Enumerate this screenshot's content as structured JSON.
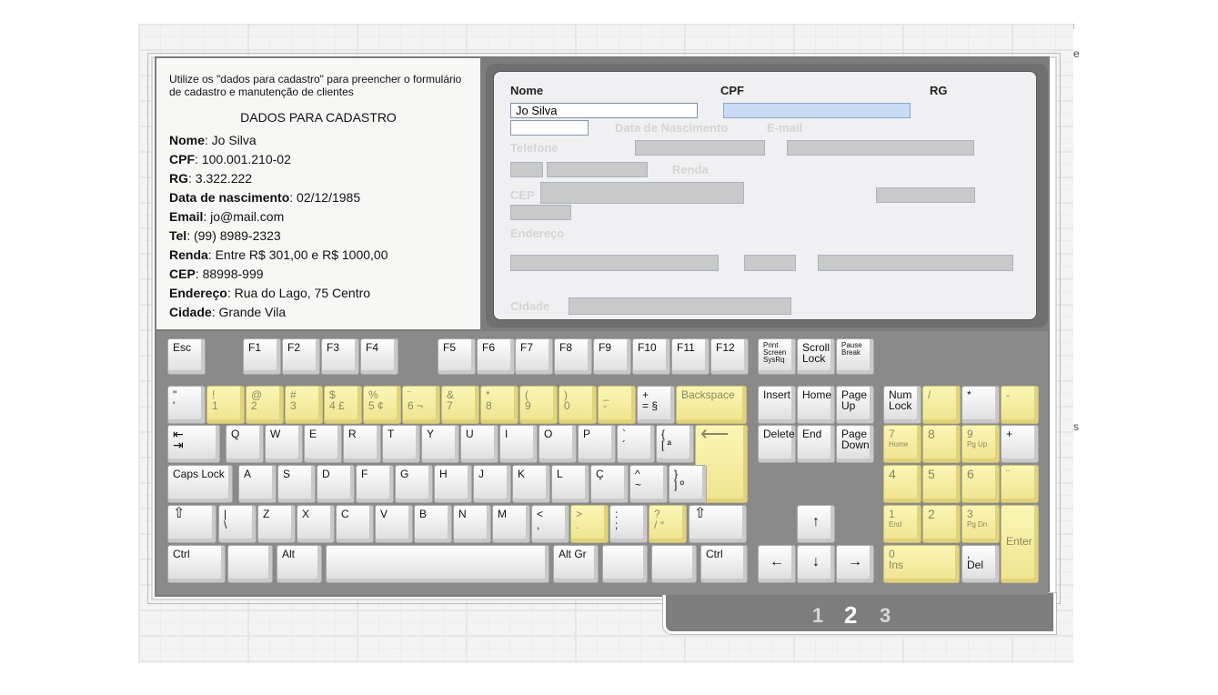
{
  "info": {
    "intro": "Utilize os \"dados para cadastro\" para preencher o formulário de cadastro e manutenção de clientes",
    "heading": "DADOS PARA CADASTRO",
    "rows": [
      {
        "label": "Nome",
        "value": ": Jo Silva"
      },
      {
        "label": "CPF",
        "value": ": 100.001.210-02"
      },
      {
        "label": "RG",
        "value": ": 3.322.222"
      },
      {
        "label": "Data de nascimento",
        "value": ": 02/12/1985"
      },
      {
        "label": "Email",
        "value": ": jo@mail.com"
      },
      {
        "label": "Tel",
        "value": ": (99) 8989-2323"
      },
      {
        "label": "Renda",
        "value": ": Entre R$ 301,00 e R$ 1000,00"
      },
      {
        "label": "CEP",
        "value": ": 88998-999"
      },
      {
        "label": "Endereço",
        "value": ": Rua do Lago, 75 Centro"
      },
      {
        "label": "Cidade",
        "value": ": Grande Vila"
      }
    ]
  },
  "form": {
    "labels": {
      "nome": "Nome",
      "cpf": "CPF",
      "rg": "RG",
      "nascimento": "Data de Nascimento",
      "email": "E-mail",
      "telefone": "Telefone",
      "renda": "Renda",
      "cep": "CEP",
      "endereco": "Endereço",
      "cidade": "Cidade"
    },
    "nome_value": "Jo Silva"
  },
  "keyboard": {
    "fn_row": [
      "Esc",
      "F1",
      "F2",
      "F3",
      "F4",
      "F5",
      "F6",
      "F7",
      "F8",
      "F9",
      "F10",
      "F11",
      "F12"
    ],
    "print": [
      "Print",
      "Screen",
      "SysRq"
    ],
    "scroll": [
      "Scroll",
      "Lock"
    ],
    "pause": [
      "Pause",
      "Break"
    ],
    "num_row": [
      {
        "t": "\"",
        "b": "'"
      },
      {
        "t": "!",
        "b": "1"
      },
      {
        "t": "@",
        "b": "2"
      },
      {
        "t": "#",
        "b": "3"
      },
      {
        "t": "$",
        "b": "4 £"
      },
      {
        "t": "%",
        "b": "5 ¢"
      },
      {
        "t": "¨",
        "b": "6 ¬"
      },
      {
        "t": "&",
        "b": "7"
      },
      {
        "t": "*",
        "b": "8"
      },
      {
        "t": "(",
        "b": "9"
      },
      {
        "t": ")",
        "b": "0"
      },
      {
        "t": "_",
        "b": "-"
      },
      {
        "t": "+",
        "b": "= §"
      }
    ],
    "backspace": "Backspace",
    "tab_glyph": "⇤\n⇥",
    "q_row": [
      "Q",
      "W",
      "E",
      "R",
      "T",
      "Y",
      "U",
      "I",
      "O",
      "P"
    ],
    "q_extra": [
      {
        "t": "`",
        "b": "´"
      },
      {
        "t": "{",
        "b": "[ ª"
      }
    ],
    "enter_glyph": "⟵",
    "caps": "Caps Lock",
    "a_row": [
      "A",
      "S",
      "D",
      "F",
      "G",
      "H",
      "J",
      "K",
      "L",
      "Ç"
    ],
    "a_extra": [
      {
        "t": "^",
        "b": "~"
      },
      {
        "t": "}",
        "b": "] º"
      }
    ],
    "shift_glyph": "⇧",
    "z_row": [
      {
        "t": "|",
        "b": "\\"
      },
      {
        "t": "Z",
        "b": ""
      },
      {
        "t": "X",
        "b": ""
      },
      {
        "t": "C",
        "b": ""
      },
      {
        "t": "V",
        "b": ""
      },
      {
        "t": "B",
        "b": ""
      },
      {
        "t": "N",
        "b": ""
      },
      {
        "t": "M",
        "b": ""
      },
      {
        "t": "<",
        "b": ","
      },
      {
        "t": ">",
        "b": "."
      },
      {
        "t": ":",
        "b": ";"
      },
      {
        "t": "?",
        "b": "/ °"
      }
    ],
    "ctrl": "Ctrl",
    "alt": "Alt",
    "altgr": "Alt Gr",
    "nav": {
      "insert": "Insert",
      "home": "Home",
      "pageup": [
        "Page",
        "Up"
      ],
      "delete": "Delete",
      "end": "End",
      "pagedown": [
        "Page",
        "Down"
      ]
    },
    "arrows": {
      "up": "↑",
      "left": "←",
      "down": "↓",
      "right": "→"
    },
    "numpad": {
      "numlock": [
        "Num",
        "Lock"
      ],
      "slash": "/",
      "star": "*",
      "minus": "-",
      "plus": "+",
      "n7": [
        "7",
        "Home"
      ],
      "n8": "8",
      "n9": [
        "9",
        "Pg Up"
      ],
      "n4": "4",
      "n5": "5",
      "n6": "6",
      "comma": "¨",
      "n1": [
        "1",
        "End"
      ],
      "n2": "2",
      "n3": [
        "3",
        "Pg Dn"
      ],
      "enter": "Enter",
      "n0": [
        "0",
        "Ins"
      ],
      "del": [
        ",",
        "Del"
      ]
    }
  },
  "pagination": [
    "1",
    "2",
    "3"
  ],
  "edge": {
    "e": "e",
    "s": "s"
  }
}
